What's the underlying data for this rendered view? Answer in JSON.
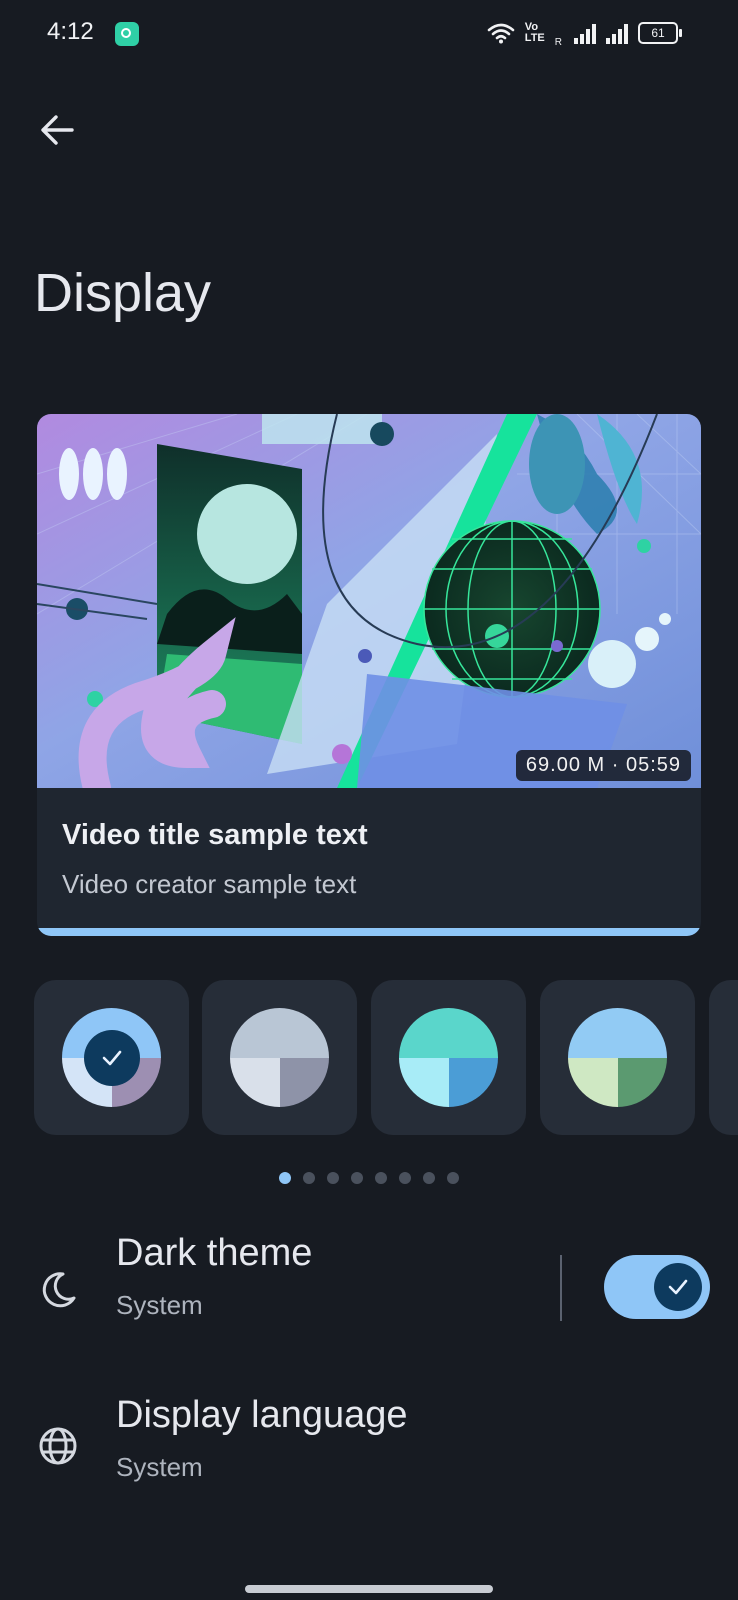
{
  "status_bar": {
    "time": "4:12",
    "volte_label": "Vo\nLTE",
    "roaming_label": "R",
    "battery_level": "61"
  },
  "header": {
    "back_icon": "arrow-back-icon",
    "title": "Display"
  },
  "preview": {
    "duration": "69.00 M · 05:59",
    "video_title": "Video title sample text",
    "video_creator": "Video creator sample text",
    "progress_color": "#8fc6f7"
  },
  "color_swatches": [
    {
      "top": "#8fc6f7",
      "bottom_left": "#d4e4f7",
      "bottom_right": "#9d8fb2",
      "selected": true
    },
    {
      "top": "#b9c6d5",
      "bottom_left": "#d9e0ea",
      "bottom_right": "#8e93a8",
      "selected": false
    },
    {
      "top": "#5ad6cb",
      "bottom_left": "#a8ecf7",
      "bottom_right": "#4b9dd6",
      "selected": false
    },
    {
      "top": "#92cbf4",
      "bottom_left": "#cfe8c3",
      "bottom_right": "#5b9a70",
      "selected": false
    }
  ],
  "pager": {
    "count": 8,
    "active_index": 0
  },
  "settings": {
    "dark_theme": {
      "label": "Dark theme",
      "value": "System",
      "icon": "moon-icon",
      "enabled": true
    },
    "display_language": {
      "label": "Display language",
      "value": "System",
      "icon": "globe-icon"
    }
  },
  "colors": {
    "background": "#171b22",
    "accent": "#8fc6f7",
    "accent_dark": "#0d3a5e",
    "card": "#1f2630"
  }
}
